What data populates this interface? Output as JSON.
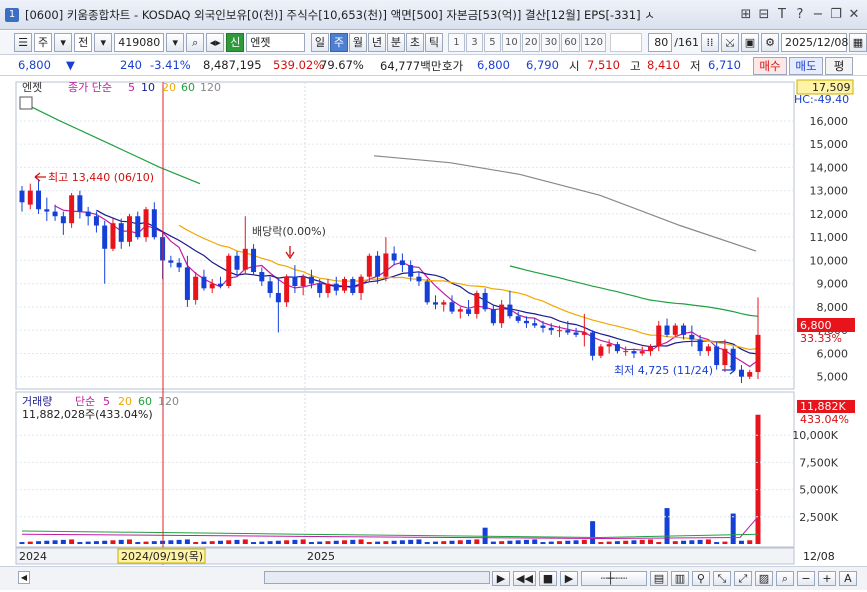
{
  "window": {
    "num": "1",
    "title": "[0600] 키움종합차트 - KOSDAQ 외국인보유[0(천)] 주식수[10,653(천)] 액면[500] 자본금[53(억)] 결산[12월] EPS[-331] ㅅ"
  },
  "toolbar": {
    "ju": "주",
    "jeon": "전",
    "code": "419080",
    "shin": "신",
    "name": "엔젯",
    "periods": [
      "일",
      "주",
      "월",
      "년",
      "분",
      "초",
      "틱"
    ],
    "active_period": "주",
    "nums": [
      "1",
      "3",
      "5",
      "10",
      "20",
      "30",
      "60",
      "120"
    ],
    "count": "80",
    "total": "/161",
    "date": "2025/12/08"
  },
  "info": {
    "price": "6,800",
    "change": "240",
    "rate": "-3.41%",
    "volume": "8,487,195",
    "vol_rate": "539.02%",
    "pct": "79.67%",
    "amount": "64,777백만",
    "hoga_label": "호가",
    "bid": "6,800",
    "ask": "6,790",
    "open_label": "시",
    "open": "7,510",
    "high_label": "고",
    "high": "8,410",
    "low_label": "저",
    "low": "6,710",
    "buy": "매수",
    "sell": "매도",
    "eval": "평"
  },
  "chart_labels": {
    "stock": "엔젯",
    "ma_title": "종가 단순",
    "ma5": "5",
    "ma10": "10",
    "ma20": "20",
    "ma60": "60",
    "ma120": "120",
    "price_top": "17,509",
    "hc": "HC:-49.40",
    "max_label": "최고 13,440 (06/10)",
    "min_label": "최저 4,725 (11/24)",
    "div_label": "배당락(0.00%)",
    "cur_price": "6,800",
    "cur_pct": "33.33%",
    "vol_title": "거래량",
    "vol_ma_title": "단순",
    "vol_value": "11,882,028주(433.04%)",
    "vol_max": "11,882K",
    "vol_pct": "433.04%",
    "x_2024": "2024",
    "x_2025": "2025",
    "x_date": "2024/09/19(목)",
    "x_last": "12/08"
  },
  "colors": {
    "up": "#e8141c",
    "down": "#1540d8",
    "ma5": "#c41aa6",
    "ma10": "#1b1b8c",
    "ma20": "#f0a800",
    "ma60": "#20a040",
    "ma120": "#888888"
  },
  "chart_data": {
    "type": "candlestick",
    "y_ticks": [
      5000,
      6000,
      7000,
      8000,
      9000,
      10000,
      11000,
      12000,
      13000,
      14000,
      15000,
      16000
    ],
    "ylim": [
      4600,
      17500
    ],
    "vol_ticks": [
      "2,500K",
      "5,000K",
      "7,500K",
      "10,000K"
    ],
    "candles": [
      [
        13000,
        13200,
        12100,
        12500
      ],
      [
        12400,
        13300,
        12200,
        13000
      ],
      [
        13000,
        13440,
        12000,
        12200
      ],
      [
        12200,
        12700,
        11700,
        12100
      ],
      [
        12100,
        12400,
        11700,
        11900
      ],
      [
        11900,
        12100,
        11100,
        11600
      ],
      [
        11600,
        12900,
        11400,
        12800
      ],
      [
        12800,
        13000,
        11800,
        12100
      ],
      [
        12100,
        12300,
        11500,
        11900
      ],
      [
        11900,
        12100,
        11200,
        11500
      ],
      [
        11500,
        11700,
        9000,
        10500
      ],
      [
        10500,
        11800,
        10400,
        11600
      ],
      [
        11600,
        11800,
        10500,
        10800
      ],
      [
        10800,
        12000,
        10600,
        11900
      ],
      [
        11900,
        12100,
        10900,
        11000
      ],
      [
        11000,
        12300,
        10800,
        12200
      ],
      [
        12200,
        12500,
        10900,
        11000
      ],
      [
        11000,
        11200,
        9200,
        10000
      ],
      [
        10000,
        10200,
        9700,
        9900
      ],
      [
        9900,
        10100,
        9500,
        9700
      ],
      [
        9700,
        10200,
        8000,
        8300
      ],
      [
        8300,
        9500,
        8100,
        9300
      ],
      [
        9300,
        9600,
        8700,
        8800
      ],
      [
        8800,
        9200,
        8600,
        9000
      ],
      [
        9000,
        9300,
        8800,
        8900
      ],
      [
        8900,
        10300,
        8800,
        10200
      ],
      [
        10200,
        10400,
        9300,
        9600
      ],
      [
        9600,
        11900,
        9400,
        10500
      ],
      [
        10500,
        10700,
        9400,
        9500
      ],
      [
        9500,
        9700,
        8900,
        9100
      ],
      [
        9100,
        9300,
        8400,
        8600
      ],
      [
        8600,
        9200,
        6900,
        8200
      ],
      [
        8200,
        9400,
        8000,
        9300
      ],
      [
        9300,
        9800,
        8600,
        8900
      ],
      [
        8900,
        9400,
        8500,
        9300
      ],
      [
        9300,
        9600,
        8800,
        9000
      ],
      [
        9000,
        9200,
        8400,
        8600
      ],
      [
        8600,
        9200,
        8400,
        9000
      ],
      [
        9000,
        9300,
        8500,
        8700
      ],
      [
        8700,
        9300,
        8600,
        9200
      ],
      [
        9200,
        9300,
        8500,
        8600
      ],
      [
        8600,
        9400,
        8300,
        9300
      ],
      [
        9300,
        10300,
        9100,
        10200
      ],
      [
        10200,
        10400,
        9000,
        9300
      ],
      [
        9300,
        11000,
        9100,
        10300
      ],
      [
        10300,
        10600,
        9800,
        10000
      ],
      [
        10000,
        10300,
        9500,
        9800
      ],
      [
        9800,
        10000,
        9100,
        9300
      ],
      [
        9300,
        9500,
        8900,
        9100
      ],
      [
        9100,
        9200,
        8100,
        8200
      ],
      [
        8200,
        8500,
        7900,
        8100
      ],
      [
        8100,
        8300,
        7800,
        8200
      ],
      [
        8200,
        8500,
        7700,
        7800
      ],
      [
        7800,
        8000,
        7500,
        7900
      ],
      [
        7900,
        8300,
        7600,
        7700
      ],
      [
        7700,
        8700,
        7500,
        8600
      ],
      [
        8600,
        8800,
        7800,
        7900
      ],
      [
        7900,
        8100,
        7200,
        7300
      ],
      [
        7300,
        8300,
        7100,
        8100
      ],
      [
        8100,
        8700,
        7500,
        7600
      ],
      [
        7600,
        7800,
        7300,
        7400
      ],
      [
        7400,
        7600,
        7100,
        7300
      ],
      [
        7300,
        7500,
        7100,
        7200
      ],
      [
        7200,
        7400,
        6900,
        7100
      ],
      [
        7100,
        7300,
        6800,
        7000
      ],
      [
        7000,
        7200,
        6700,
        7000
      ],
      [
        7000,
        7400,
        6800,
        6900
      ],
      [
        6900,
        7100,
        6700,
        6800
      ],
      [
        6800,
        7700,
        6300,
        6900
      ],
      [
        6900,
        7000,
        5700,
        5900
      ],
      [
        5900,
        6400,
        5800,
        6300
      ],
      [
        6300,
        6600,
        6000,
        6400
      ],
      [
        6400,
        6500,
        6000,
        6100
      ],
      [
        6100,
        6300,
        5900,
        6100
      ],
      [
        6100,
        6200,
        5800,
        6000
      ],
      [
        6000,
        6300,
        5900,
        6100
      ],
      [
        6100,
        6400,
        5900,
        6300
      ],
      [
        6300,
        7400,
        6100,
        7200
      ],
      [
        7200,
        7500,
        6700,
        6800
      ],
      [
        6800,
        7300,
        6700,
        7200
      ],
      [
        7200,
        7300,
        6600,
        6800
      ],
      [
        6800,
        7200,
        6300,
        6600
      ],
      [
        6600,
        6800,
        5900,
        6100
      ],
      [
        6100,
        6400,
        5900,
        6300
      ],
      [
        6300,
        6500,
        5300,
        5500
      ],
      [
        5500,
        6600,
        5200,
        6200
      ],
      [
        6200,
        6300,
        5200,
        5300
      ],
      [
        5300,
        5500,
        4725,
        5000
      ],
      [
        5000,
        5300,
        4900,
        5200
      ],
      [
        5200,
        8410,
        4900,
        6800
      ]
    ],
    "volume_spikes": [
      [
        56,
        1500
      ],
      [
        69,
        2100
      ],
      [
        78,
        3300
      ],
      [
        86,
        2800
      ],
      [
        89,
        11882
      ]
    ]
  }
}
